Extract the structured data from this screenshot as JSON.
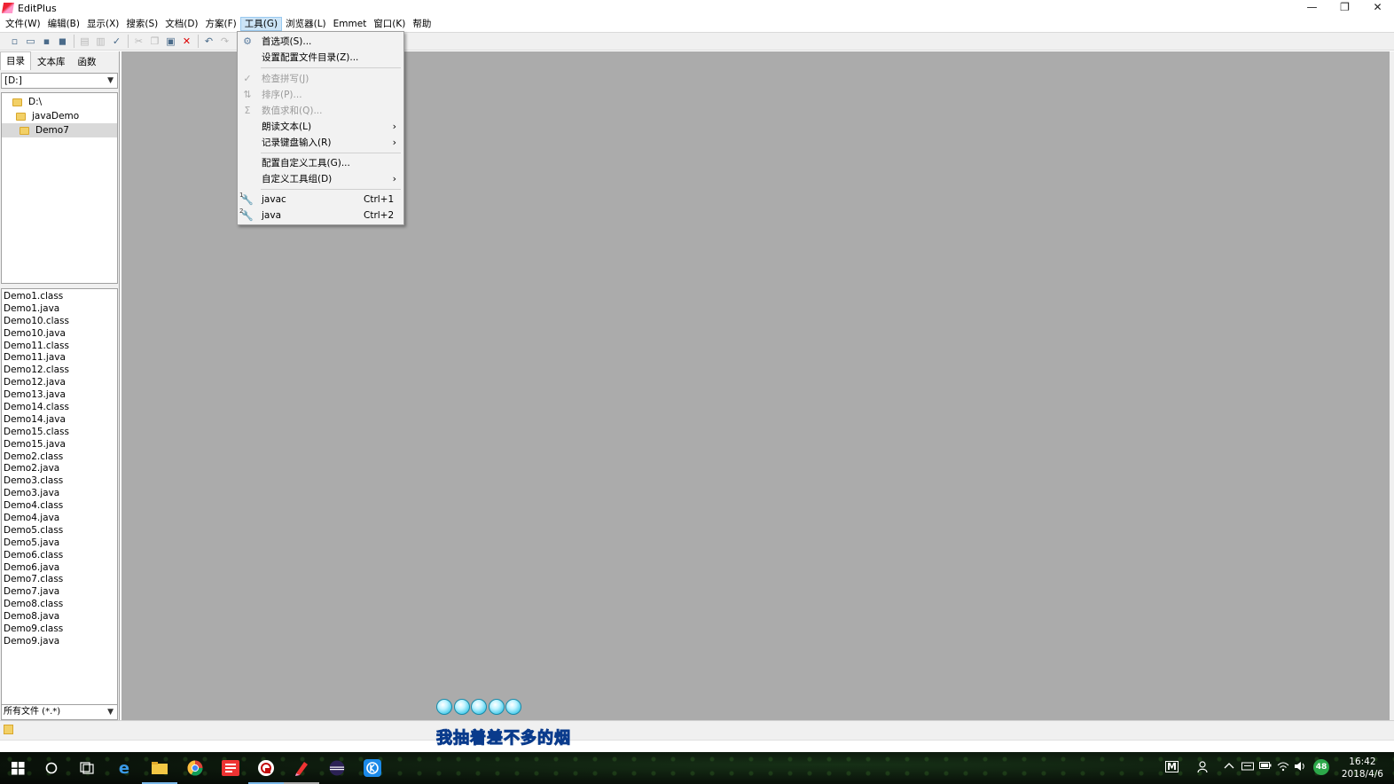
{
  "window": {
    "title": "EditPlus",
    "minimize": "—",
    "restore": "❐",
    "close": "✕"
  },
  "menubar": [
    "文件(W)",
    "编辑(B)",
    "显示(X)",
    "搜索(S)",
    "文档(D)",
    "方案(F)",
    "工具(G)",
    "浏览器(L)",
    "Emmet",
    "窗口(K)",
    "帮助"
  ],
  "active_menu": "工具(G)",
  "toolbar_icons": [
    "new-file-icon",
    "open-icon",
    "save-icon",
    "save-all-icon",
    "sep",
    "print-preview-icon",
    "print-icon",
    "spell-icon",
    "sep",
    "cut-icon",
    "copy-icon",
    "paste-icon",
    "delete-icon",
    "sep",
    "undo-icon",
    "redo-icon",
    "preferences-icon",
    "sep",
    "view1-icon",
    "view2-icon",
    "view3-icon",
    "view4-icon",
    "help-icon"
  ],
  "left_panel": {
    "tabs": [
      "目录",
      "文本库",
      "函数"
    ],
    "drive": "[D:]",
    "tree": [
      {
        "label": "D:\\",
        "indent": 1,
        "selected": false
      },
      {
        "label": "javaDemo",
        "indent": 2,
        "selected": false
      },
      {
        "label": "Demo7",
        "indent": 3,
        "selected": true
      }
    ],
    "files": [
      "Demo1.class",
      "Demo1.java",
      "Demo10.class",
      "Demo10.java",
      "Demo11.class",
      "Demo11.java",
      "Demo12.class",
      "Demo12.java",
      "Demo13.java",
      "Demo14.class",
      "Demo14.java",
      "Demo15.class",
      "Demo15.java",
      "Demo2.class",
      "Demo2.java",
      "Demo3.class",
      "Demo3.java",
      "Demo4.class",
      "Demo4.java",
      "Demo5.class",
      "Demo5.java",
      "Demo6.class",
      "Demo6.java",
      "Demo7.class",
      "Demo7.java",
      "Demo8.class",
      "Demo8.java",
      "Demo9.class",
      "Demo9.java"
    ],
    "filter": "所有文件 (*.*)"
  },
  "dropdown": {
    "preferences": "首选项(S)...",
    "config_dir": "设置配置文件目录(Z)...",
    "spell": "检查拼写(J)",
    "sort": "排序(P)...",
    "sum": "数值求和(Q)...",
    "speak": "朗读文本(L)",
    "record": "记录键盘输入(R)",
    "config_tools": "配置自定义工具(G)...",
    "tool_group": "自定义工具组(D)",
    "javac": "javac",
    "javac_sc": "Ctrl+1",
    "java": "java",
    "java_sc": "Ctrl+2",
    "submenu_arrow": "›",
    "tool_badge_1": "1",
    "tool_badge_2": "2"
  },
  "overlay": {
    "lyric": "我抽着差不多的烟"
  },
  "taskbar": {
    "time": "16:42",
    "date": "2018/4/6",
    "tray_m": "M",
    "tray_badge": "48"
  },
  "colors": {
    "accent": "#cce4f7",
    "workspace": "#ababab",
    "lyric": "#1e9be8"
  }
}
